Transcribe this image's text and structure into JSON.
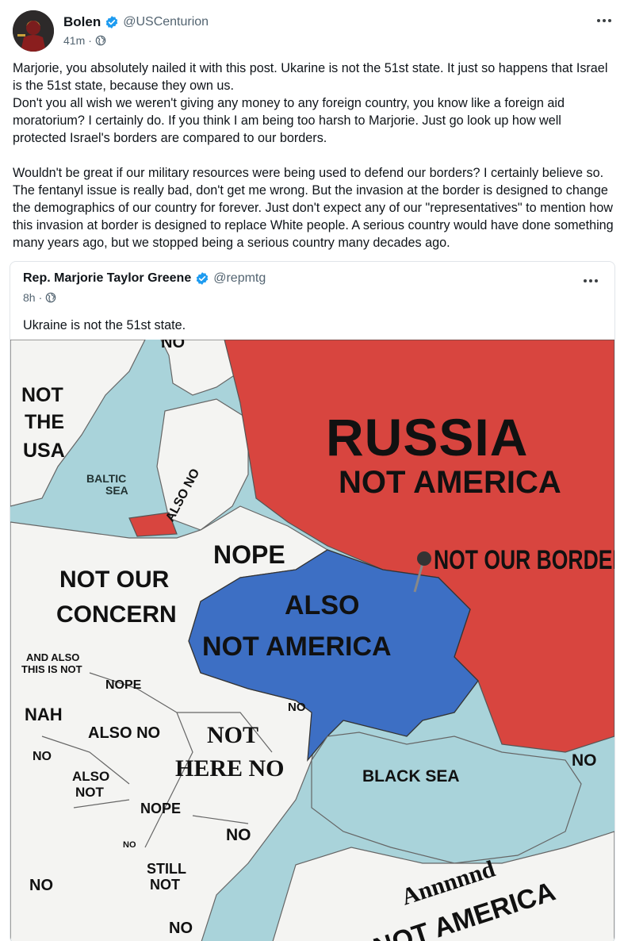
{
  "post": {
    "author": {
      "name": "Bolen",
      "handle": "@USCenturion",
      "verified": true,
      "time": "41m"
    },
    "paragraphs": [
      "Marjorie, you absolutely nailed it with this post. Ukarine is not the 51st state. It just so happens that Israel is the 51st state, because they own us.\nDon't you all wish we weren't giving any money to any foreign country, you know like a foreign aid moratorium? I certainly do. If you think I am being too harsh to Marjorie. Just go look up how well protected Israel's borders are compared to our borders.",
      "Wouldn't be great if our military resources were being used to defend our borders? I certainly believe so. The fentanyl issue is really bad, don't get me wrong. But the invasion at the border is designed to change the demographics of our country for forever. Just don't expect any of our \"representatives\" to mention how this invasion at border is designed to replace White people. A serious country would have done something many years ago, but we stopped being a serious country many decades ago."
    ],
    "icons": {
      "verified": "verified-badge-icon",
      "audience": "globe-icon",
      "more": "more-options-icon"
    }
  },
  "quoted": {
    "author": {
      "name": "Rep. Marjorie Taylor Greene",
      "handle": "@repmtg",
      "verified": true,
      "time": "8h"
    },
    "text": "Ukraine is not the 51st state.",
    "map": {
      "colors": {
        "russia": "#d8453f",
        "ukraine": "#3d6fc4",
        "sea": "#a9d3da",
        "land": "#f4f4f2"
      },
      "labels": {
        "not_the_usa_1": "NOT",
        "not_the_usa_2": "THE",
        "not_the_usa_3": "USA",
        "baltic_1": "BALTIC",
        "baltic_2": "SEA",
        "also_no_rot": "ALSO NO",
        "russia": "RUSSIA",
        "russia_not_america": "NOT AMERICA",
        "nope_top": "NOPE",
        "not_our_border": "NOT OUR BORDER",
        "not_our_concern_1": "NOT OUR",
        "not_our_concern_2": "CONCERN",
        "also_1": "ALSO",
        "also_2": "NOT AMERICA",
        "and_also_1": "AND ALSO",
        "and_also_2": "THIS IS NOT",
        "nope_small": "NOPE",
        "nah": "NAH",
        "no_small": "NO",
        "also_no_mid": "ALSO NO",
        "not_here_1": "NOT",
        "not_here_2": "HERE NO",
        "no_left": "NO",
        "also_not_1": "ALSO",
        "also_not_2": "NOT",
        "nope_bal": "NOPE",
        "black_sea": "BLACK SEA",
        "no_right": "NO",
        "no_mid": "NO",
        "no_tiny": "NO",
        "still_1": "STILL",
        "still_2": "NOT",
        "no_bottom_left": "NO",
        "no_bottom": "NO",
        "annnnnd_1": "Annnnnd",
        "annnnnd_2": "NOT AMERICA",
        "top_cut": "NO"
      }
    }
  }
}
